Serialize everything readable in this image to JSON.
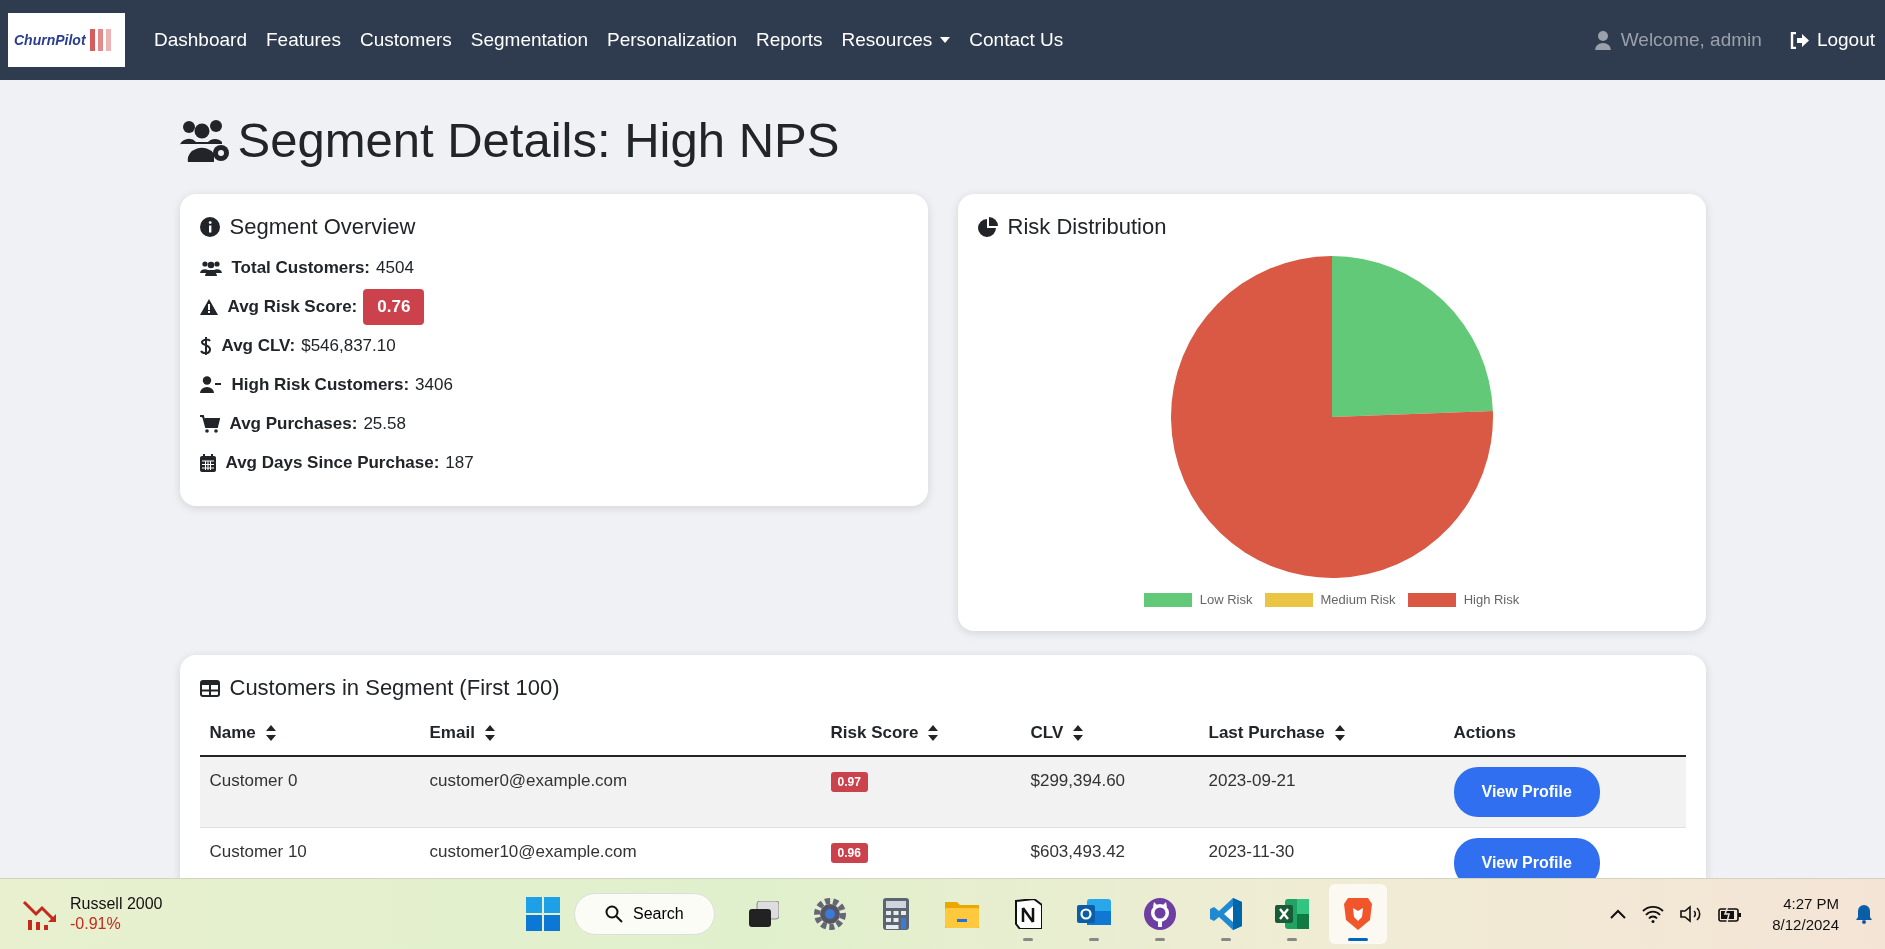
{
  "navbar": {
    "brand": "ChurnPilot",
    "links": [
      {
        "label": "Dashboard",
        "kind": "link"
      },
      {
        "label": "Features",
        "kind": "link"
      },
      {
        "label": "Customers",
        "kind": "link"
      },
      {
        "label": "Segmentation",
        "kind": "link"
      },
      {
        "label": "Personalization",
        "kind": "link"
      },
      {
        "label": "Reports",
        "kind": "link"
      },
      {
        "label": "Resources",
        "kind": "dropdown"
      },
      {
        "label": "Contact Us",
        "kind": "link"
      }
    ],
    "user": "Welcome, admin",
    "logout": "Logout"
  },
  "title": "Segment Details: High NPS",
  "overview": {
    "title": "Segment Overview",
    "stats": [
      {
        "kind": "users",
        "label": "Total Customers:",
        "value": "4504",
        "badge": false
      },
      {
        "kind": "warning",
        "label": "Avg Risk Score:",
        "value": "0.76",
        "badge": true
      },
      {
        "kind": "dollar",
        "label": "Avg CLV:",
        "value": "$546,837.10",
        "badge": false
      },
      {
        "kind": "user-minus",
        "label": "High Risk Customers:",
        "value": "3406",
        "badge": false
      },
      {
        "kind": "cart",
        "label": "Avg Purchases:",
        "value": "25.58",
        "badge": false
      },
      {
        "kind": "calendar",
        "label": "Avg Days Since Purchase:",
        "value": "187",
        "badge": false
      }
    ]
  },
  "risk_chart": {
    "title": "Risk Distribution",
    "chart_data": {
      "type": "pie",
      "categories": [
        "Low Risk",
        "Medium Risk",
        "High Risk"
      ],
      "values": [
        24.4,
        0,
        75.6
      ],
      "legend": "bottom"
    }
  },
  "customers_table": {
    "title": "Customers in Segment (First 100)",
    "columns": [
      {
        "label": "Name",
        "sortable": true
      },
      {
        "label": "Email",
        "sortable": true
      },
      {
        "label": "Risk Score",
        "sortable": true
      },
      {
        "label": "CLV",
        "sortable": true
      },
      {
        "label": "Last Purchase",
        "sortable": true
      },
      {
        "label": "Actions",
        "sortable": false
      }
    ],
    "rows": [
      {
        "cells": [
          "Customer 0",
          "customer0@example.com",
          "0.97",
          "$299,394.60",
          "2023-09-21"
        ],
        "action": "View Profile"
      },
      {
        "cells": [
          "Customer 10",
          "customer10@example.com",
          "0.96",
          "$603,493.42",
          "2023-11-30"
        ],
        "action": "View Profile"
      }
    ]
  },
  "taskbar": {
    "widget": {
      "name": "Russell 2000",
      "change": "-0.91%"
    },
    "search": "Search",
    "apps": [
      {
        "kind": "taskview",
        "running": false,
        "selected": false
      },
      {
        "kind": "settings",
        "running": false,
        "selected": false
      },
      {
        "kind": "calculator",
        "running": false,
        "selected": false
      },
      {
        "kind": "folder",
        "running": false,
        "selected": false
      },
      {
        "kind": "notes",
        "running": true,
        "selected": false
      },
      {
        "kind": "mail",
        "running": true,
        "selected": false
      },
      {
        "kind": "cat",
        "running": true,
        "selected": false
      },
      {
        "kind": "code",
        "running": true,
        "selected": false
      },
      {
        "kind": "sheet",
        "running": true,
        "selected": false
      },
      {
        "kind": "lion",
        "running": true,
        "selected": true
      }
    ],
    "time": "4:27 PM",
    "date": "8/12/2024"
  }
}
